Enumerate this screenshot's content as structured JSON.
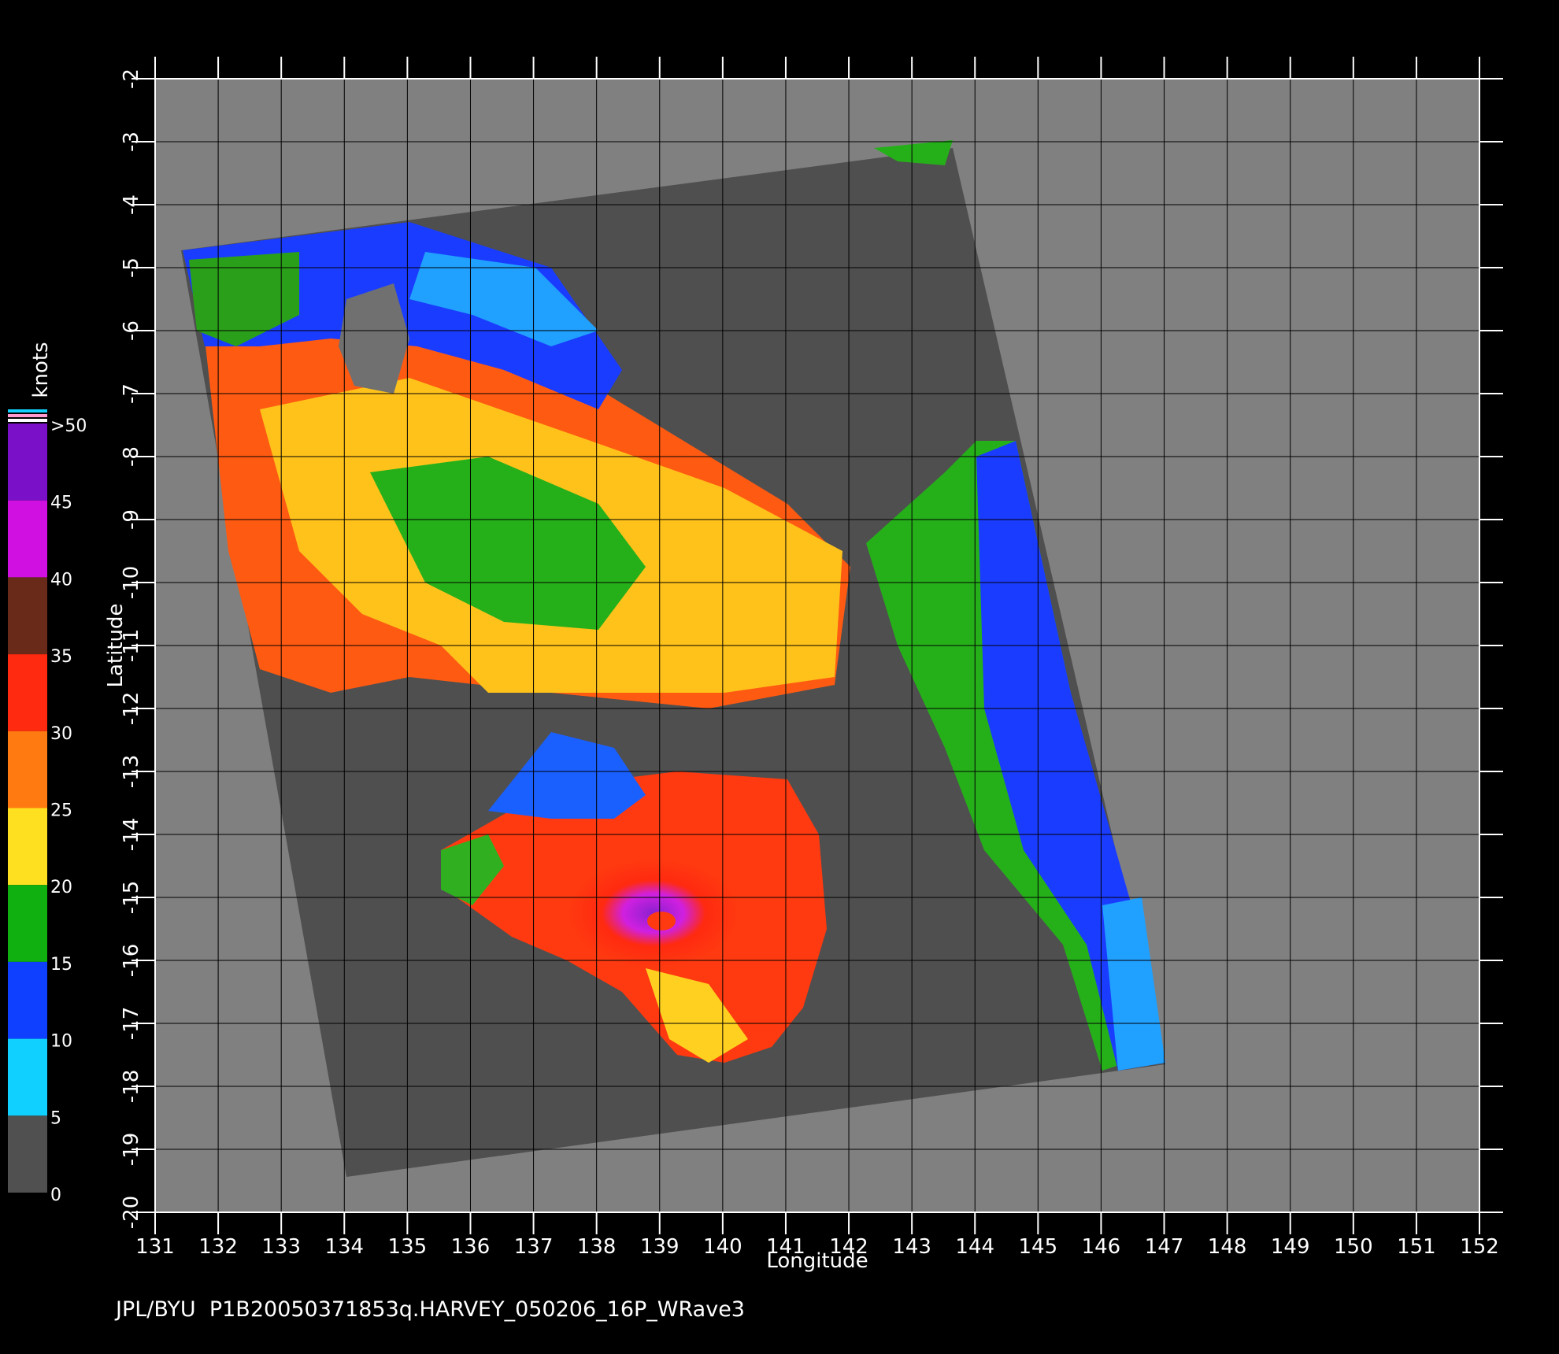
{
  "map": {
    "x_axis_label": "Longitude",
    "y_axis_label": "Latitude",
    "x_ticks": [
      "131",
      "132",
      "133",
      "134",
      "135",
      "136",
      "137",
      "138",
      "139",
      "140",
      "141",
      "142",
      "143",
      "144",
      "145",
      "146",
      "147",
      "148",
      "149",
      "150",
      "151",
      "152"
    ],
    "y_ticks": [
      "-2",
      "-3",
      "-4",
      "-5",
      "-6",
      "-7",
      "-8",
      "-9",
      "-10",
      "-11",
      "-12",
      "-13",
      "-14",
      "-15",
      "-16",
      "-17",
      "-18",
      "-19",
      "-20"
    ],
    "lon_range": [
      131,
      152
    ],
    "lat_range": [
      -2,
      -20
    ],
    "footer": "JPL/BYU  P1B20050371853q.HARVEY_050206_16P_WRave3",
    "storm_center": {
      "lon": 139.2,
      "lat": -15.5
    }
  },
  "colorbar": {
    "units": "knots",
    "labels": [
      ">50",
      "45",
      "40",
      "35",
      "30",
      "25",
      "20",
      "15",
      "10",
      "5",
      "0"
    ],
    "bands": [
      {
        "from": 45,
        "to": 50,
        "color": "#7a10c8"
      },
      {
        "from": 40,
        "to": 45,
        "color": "#d010e0"
      },
      {
        "from": 35,
        "to": 40,
        "color": "#6a2a1a"
      },
      {
        "from": 30,
        "to": 35,
        "color": "#ff2a10"
      },
      {
        "from": 25,
        "to": 30,
        "color": "#ff7a10"
      },
      {
        "from": 20,
        "to": 25,
        "color": "#ffe020"
      },
      {
        "from": 15,
        "to": 20,
        "color": "#10b010"
      },
      {
        "from": 10,
        "to": 15,
        "color": "#1040ff"
      },
      {
        "from": 5,
        "to": 10,
        "color": "#10d0ff"
      },
      {
        "from": 0,
        "to": 5,
        "color": "#505050"
      }
    ]
  }
}
